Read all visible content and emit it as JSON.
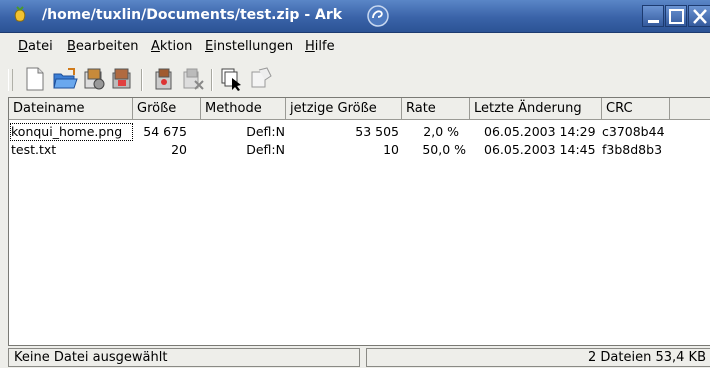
{
  "window": {
    "title": "/home/tuxlin/Documents/test.zip - Ark",
    "app_icon": "ark-icon",
    "buttons": [
      "sticky-icon",
      "minimize-icon",
      "maximize-icon",
      "close-icon"
    ]
  },
  "menu": {
    "items": [
      {
        "accel": "D",
        "rest": "atei"
      },
      {
        "accel": "B",
        "rest": "earbeiten"
      },
      {
        "accel": "A",
        "rest": "ktion"
      },
      {
        "accel": "E",
        "rest": "instellungen"
      },
      {
        "accel": "H",
        "rest": "ilfe"
      }
    ]
  },
  "toolbar": {
    "buttons": [
      "new-archive-icon",
      "open-archive-icon",
      "add-file-icon",
      "add-folder-icon",
      "extract-icon",
      "delete-icon",
      "select-icon",
      "view-icon"
    ]
  },
  "list": {
    "columns": [
      "Dateiname",
      "Größe",
      "Methode",
      "jetzige Größe",
      "Rate",
      "Letzte Änderung",
      "CRC"
    ],
    "rows": [
      [
        "konqui_home.png",
        "54 675",
        "Defl:N",
        "53 505",
        "2,0 %",
        "06.05.2003 14:29",
        "c3708b44"
      ],
      [
        "test.txt",
        "20",
        "Defl:N",
        "10",
        "50,0 %",
        "06.05.2003 14:45",
        "f3b8d8b3"
      ]
    ]
  },
  "status": {
    "left": "Keine Datei ausgewählt",
    "right": "2 Dateien  53,4 KB"
  },
  "colors": {
    "titlebar": "#3a63a8",
    "background": "#eeeeea"
  }
}
